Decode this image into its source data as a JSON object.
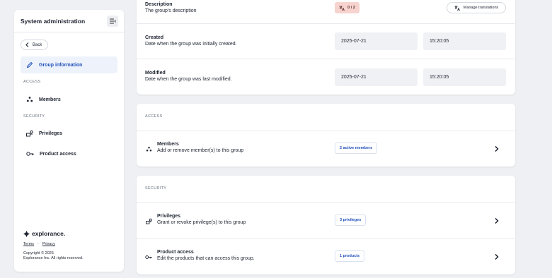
{
  "sidebar": {
    "title": "System administration",
    "back_label": "Back",
    "nav": {
      "group_information": "Group information",
      "access_section": "ACCESS",
      "members": "Members",
      "security_section": "SECURITY",
      "privileges": "Privileges",
      "product_access": "Product access"
    },
    "footer": {
      "logo_text": "explorance.",
      "terms": "Terms",
      "separator": "·",
      "privacy": "Privacy",
      "copyright_line1": "Copyright © 2025",
      "copyright_line2": "Explorance Inc. All rights reserved."
    }
  },
  "info_card": {
    "description": {
      "title": "Description",
      "subtitle": "The group's description",
      "translation_count": "0 / 2",
      "manage_translations": "Manage translations"
    },
    "created": {
      "title": "Created",
      "subtitle": "Date when the group was initially created.",
      "date": "2025-07-21",
      "time": "15:20:05"
    },
    "modified": {
      "title": "Modified",
      "subtitle": "Date when the group was last modified.",
      "date": "2025-07-21",
      "time": "15:20:05"
    }
  },
  "access_card": {
    "section": "ACCESS",
    "members": {
      "title": "Members",
      "subtitle": "Add or remove member(s) to this group",
      "badge": "2 active members"
    }
  },
  "security_card": {
    "section": "SECURITY",
    "privileges": {
      "title": "Privileges",
      "subtitle": "Grant or revoke privilege(s) to this group",
      "badge": "3 privileges"
    },
    "product_access": {
      "title": "Product access",
      "subtitle": "Edit the products that can access this group.",
      "badge": "1 products"
    }
  },
  "colors": {
    "accent": "#1f4fb8",
    "active_nav_bg": "#eef3fb",
    "translation_badge_bg": "#f7d3cf"
  }
}
